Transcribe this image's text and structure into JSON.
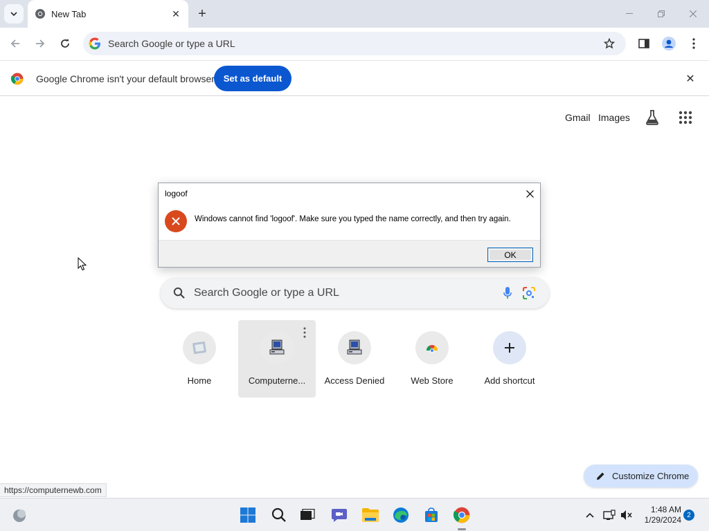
{
  "tab": {
    "title": "New Tab"
  },
  "omnibox": {
    "placeholder": "Search Google or type a URL"
  },
  "infobar": {
    "message": "Google Chrome isn't your default browser",
    "button": "Set as default"
  },
  "ntp": {
    "links": {
      "gmail": "Gmail",
      "images": "Images"
    },
    "search_placeholder": "Search Google or type a URL",
    "shortcuts": [
      {
        "label": "Home"
      },
      {
        "label": "Computerne..."
      },
      {
        "label": "Access Denied"
      },
      {
        "label": "Web Store"
      },
      {
        "label": "Add shortcut"
      }
    ],
    "customize": "Customize Chrome"
  },
  "status_url": "https://computernewb.com",
  "dialog": {
    "title": "logoof",
    "message": "Windows cannot find 'logoof'. Make sure you typed the name correctly, and then try again.",
    "ok": "OK"
  },
  "taskbar": {
    "time": "1:48 AM",
    "date": "1/29/2024",
    "notifications": "2"
  },
  "colors": {
    "accent": "#0b57d0",
    "error": "#d8491e",
    "customize_bg": "#d3e3fd"
  }
}
